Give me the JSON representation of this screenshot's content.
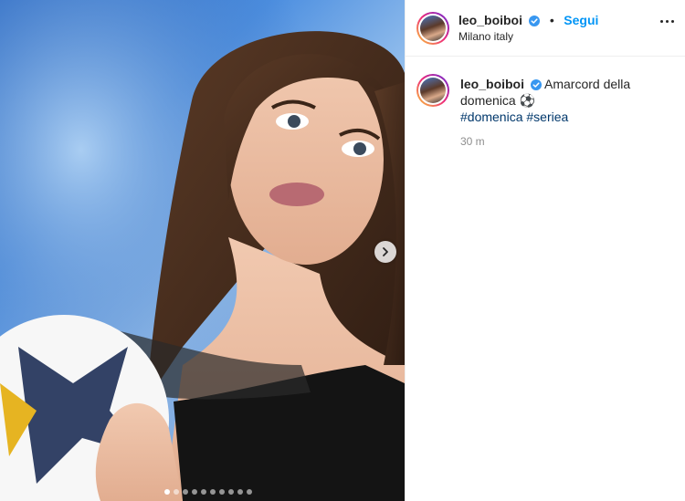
{
  "post": {
    "username": "leo_boiboi",
    "follow_label": "Segui",
    "separator": "•",
    "location": "Milano italy",
    "caption_text": "Amarcord della domenica ⚽",
    "hashtags": [
      "#domenica",
      "#seriea"
    ],
    "time_ago": "30 m"
  },
  "carousel": {
    "slide_count": 10,
    "active_index": 0
  },
  "colors": {
    "follow": "#0095f6",
    "hashtag": "#00376b",
    "verified": "#3897f0"
  },
  "icons": {
    "verified": "verified-badge-icon",
    "next": "chevron-right-icon",
    "more": "more-options-icon"
  }
}
